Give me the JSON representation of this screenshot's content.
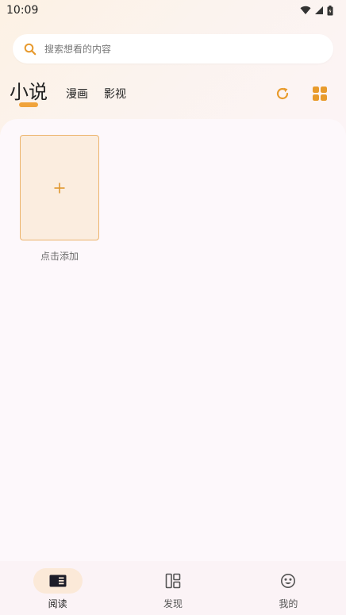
{
  "status_bar": {
    "time": "10:09"
  },
  "search": {
    "placeholder": "搜索想看的内容"
  },
  "tabs": [
    {
      "label": "小说",
      "active": true
    },
    {
      "label": "漫画",
      "active": false
    },
    {
      "label": "影视",
      "active": false
    }
  ],
  "shelf": {
    "add_label": "点击添加"
  },
  "bottom_nav": [
    {
      "label": "阅读",
      "active": true
    },
    {
      "label": "发现",
      "active": false
    },
    {
      "label": "我的",
      "active": false
    }
  ],
  "colors": {
    "accent": "#f0a33b",
    "card_bg": "#fbeddf",
    "card_border": "#ecb46d"
  }
}
